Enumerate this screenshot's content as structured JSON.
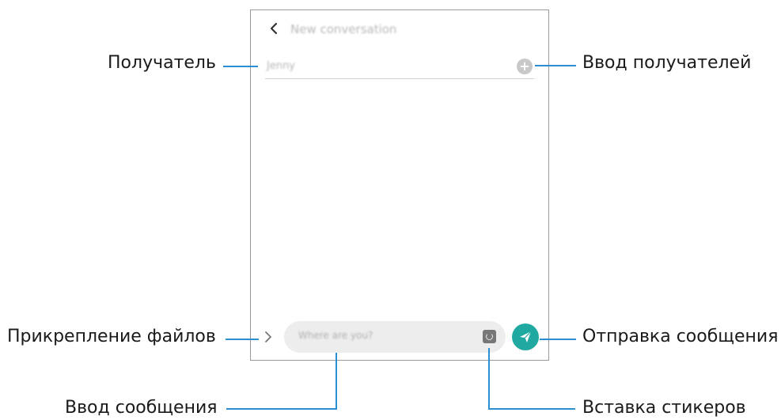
{
  "screen": {
    "title": "New conversation",
    "recipient_value": "Jenny",
    "message_text": "Where are you?",
    "icons": {
      "back": "chevron-left-icon",
      "add_recipient": "plus-circle-icon",
      "attach": "chevron-right-icon",
      "sticker": "sticker-icon",
      "send": "paper-plane-icon"
    },
    "colors": {
      "send_button": "#1fa9a0",
      "callout_line": "#2a8fd0"
    }
  },
  "callouts": {
    "recipient": "Получатель",
    "add_recipients": "Ввод получателей",
    "attach_files": "Прикрепление файлов",
    "send_message": "Отправка сообщения",
    "enter_message": "Ввод сообщения",
    "insert_stickers": "Вставка стикеров"
  }
}
